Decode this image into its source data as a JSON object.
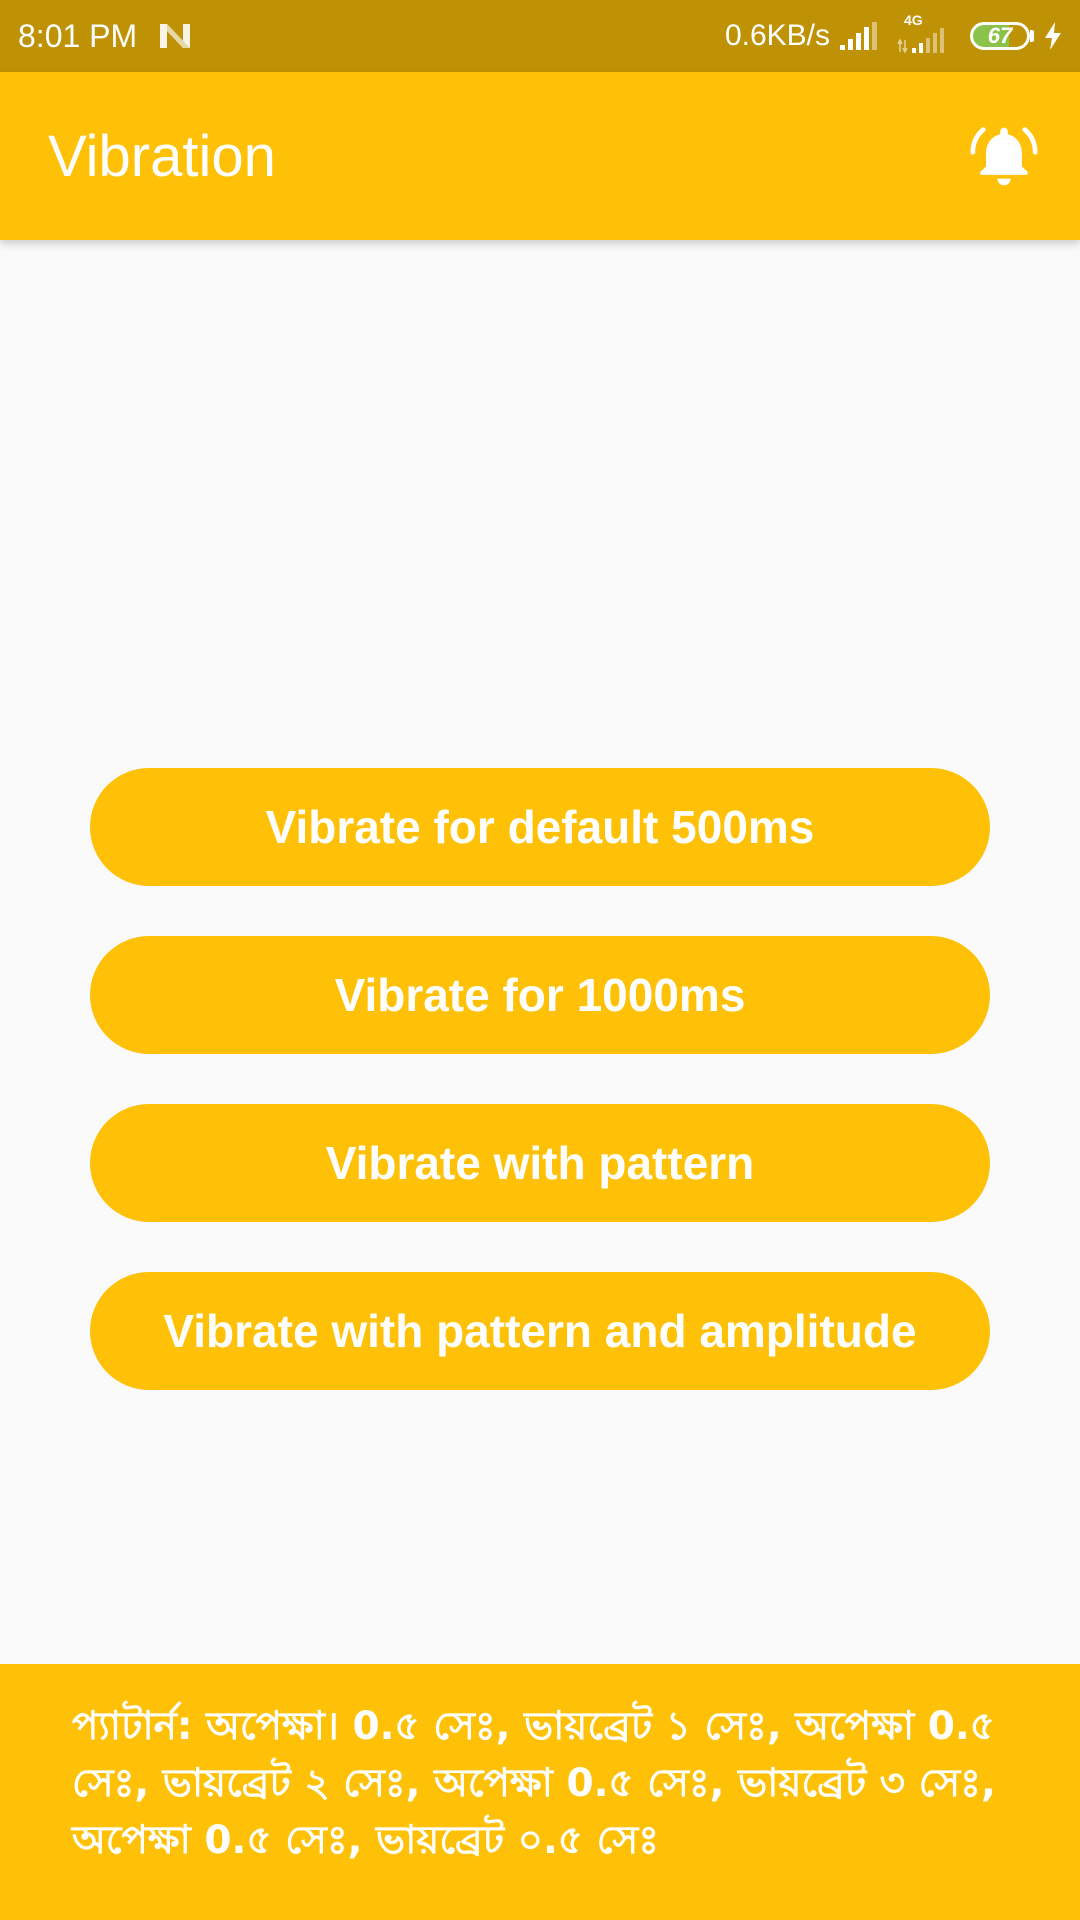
{
  "status_bar": {
    "time": "8:01 PM",
    "network_speed": "0.6KB/s",
    "network_type": "4G",
    "battery_level": "67",
    "icons": [
      "n-notification-icon",
      "signal-icon",
      "signal-4g-icon",
      "battery-icon",
      "charging-bolt-icon"
    ]
  },
  "app_bar": {
    "title": "Vibration",
    "action_icon": "bell-ringing-icon"
  },
  "buttons": {
    "default": "Vibrate for default 500ms",
    "ms1000": "Vibrate for 1000ms",
    "pattern": "Vibrate with pattern",
    "pattern_amplitude": "Vibrate with pattern and amplitude"
  },
  "footer": {
    "text": "প্যাটার্ন: অপেক্ষা। 0.৫ সেঃ, ভায়ব্রেট ১ সেঃ, অপেক্ষা 0.৫ সেঃ, ভায়ব্রেট ২ সেঃ, অপেক্ষা 0.৫ সেঃ, ভায়ব্রেট ৩ সেঃ, অপেক্ষা 0.৫ সেঃ, ভায়ব্রেট ০.৫ সেঃ"
  },
  "colors": {
    "primary": "#FFC107",
    "status_bar": "#BF9104",
    "background": "#FAFAFA",
    "battery": "#8BC34A"
  }
}
